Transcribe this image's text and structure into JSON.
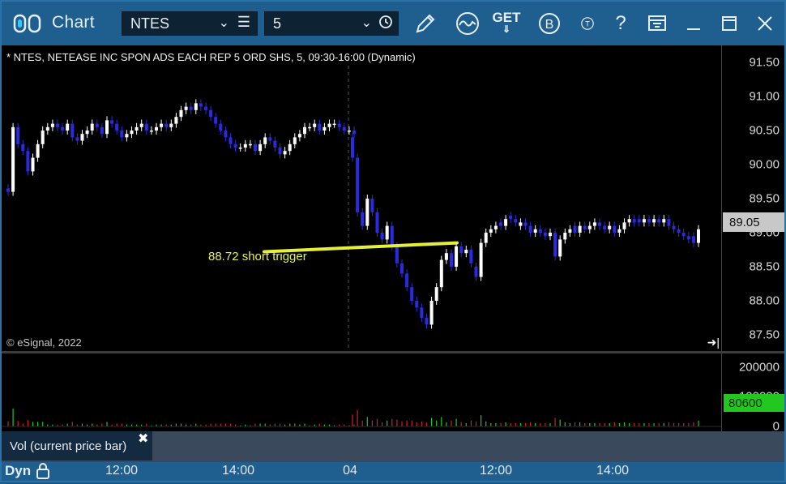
{
  "window": {
    "title": "Chart",
    "symbol_value": "NTES",
    "interval_value": "5",
    "get_label": "GET"
  },
  "chart": {
    "header": "* NTES, NETEASE INC SPON ADS EACH REP 5 ORD SHS, 5, 09:30-16:00 (Dynamic)",
    "copyright": "© eSignal, 2022",
    "annotation": "88.72 short trigger",
    "price_tag": "89.05",
    "y_ticks": [
      "91.50",
      "91.00",
      "90.50",
      "90.00",
      "89.50",
      "89.00",
      "88.50",
      "88.00",
      "87.50"
    ],
    "up_color": "#ffffff",
    "down_color": "#2a2ae0",
    "trigger_color": "#e4f03a"
  },
  "volume": {
    "label": "Vol (current price bar)",
    "ticks": [
      "200000",
      "100000",
      "0"
    ],
    "value_tag": "80600",
    "up_color": "#22c81e",
    "down_color": "#d02020"
  },
  "x_axis": {
    "mode_label": "Dyn",
    "ticks": [
      "12:00",
      "14:00",
      "04",
      "12:00",
      "14:00"
    ]
  },
  "chart_data": {
    "type": "candlestick",
    "title": "* NTES, NETEASE INC SPON ADS EACH REP 5 ORD SHS, 5, 09:30-16:00 (Dynamic)",
    "ylim": [
      87.25,
      91.75
    ],
    "annotations": [
      {
        "text": "88.72 short trigger",
        "type": "trendline"
      }
    ],
    "day1_closes": [
      89.6,
      90.55,
      90.3,
      90.2,
      89.9,
      90.1,
      90.3,
      90.5,
      90.55,
      90.6,
      90.55,
      90.5,
      90.6,
      90.4,
      90.35,
      90.45,
      90.5,
      90.6,
      90.55,
      90.45,
      90.65,
      90.6,
      90.5,
      90.4,
      90.45,
      90.5,
      90.55,
      90.6,
      90.5,
      90.5,
      90.55,
      90.6,
      90.55,
      90.6,
      90.7,
      90.8,
      90.85,
      90.8,
      90.9,
      90.85,
      90.8,
      90.7,
      90.6,
      90.5,
      90.4,
      90.3,
      90.25,
      90.25,
      90.3,
      90.3,
      90.2,
      90.3,
      90.4,
      90.35,
      90.25,
      90.15,
      90.2,
      90.3,
      90.4,
      90.45,
      90.55,
      90.55,
      90.6,
      90.5,
      90.55,
      90.6,
      90.6,
      90.55,
      90.5,
      90.5,
      90.45
    ],
    "day2_closes": [
      90.1,
      89.3,
      89.1,
      89.5,
      89.3,
      89.0,
      88.9,
      89.1,
      88.8,
      88.55,
      88.4,
      88.2,
      88.0,
      87.9,
      87.75,
      87.65,
      88.0,
      88.2,
      88.6,
      88.7,
      88.5,
      88.8,
      88.7,
      88.75,
      88.55,
      88.35,
      88.85,
      89.0,
      89.05,
      89.1,
      89.1,
      89.2,
      89.2,
      89.15,
      89.15,
      89.1,
      89.0,
      89.05,
      89.0,
      88.95,
      89.0,
      88.65,
      88.9,
      89.0,
      89.05,
      89.0,
      89.1,
      89.05,
      89.1,
      89.15,
      89.1,
      89.05,
      89.1,
      89.0,
      89.05,
      89.15,
      89.2,
      89.15,
      89.15,
      89.2,
      89.15,
      89.2,
      89.15,
      89.2,
      89.1,
      89.05,
      89.0,
      88.95,
      88.9,
      88.85,
      89.05
    ],
    "day2_opens": [
      90.4,
      90.1,
      89.3,
      89.1,
      89.5,
      89.3,
      89.0,
      88.9,
      89.1,
      88.8,
      88.55,
      88.4,
      88.2,
      88.0,
      87.9,
      87.75,
      87.65,
      88.0,
      88.2,
      88.6,
      88.7,
      88.5,
      88.8,
      88.7,
      88.75,
      88.5,
      88.35,
      88.85,
      89.0,
      89.05,
      89.15,
      89.1,
      89.25,
      89.2,
      89.1,
      89.15,
      89.1,
      89.0,
      89.05,
      89.0,
      88.95,
      89.0,
      88.65,
      88.9,
      89.0,
      89.1,
      89.0,
      89.1,
      89.05,
      89.1,
      89.15,
      89.1,
      89.05,
      89.1,
      89.0,
      89.05,
      89.15,
      89.2,
      89.2,
      89.15,
      89.2,
      89.15,
      89.2,
      89.15,
      89.2,
      89.1,
      89.05,
      89.0,
      88.95,
      88.95,
      88.85
    ]
  }
}
